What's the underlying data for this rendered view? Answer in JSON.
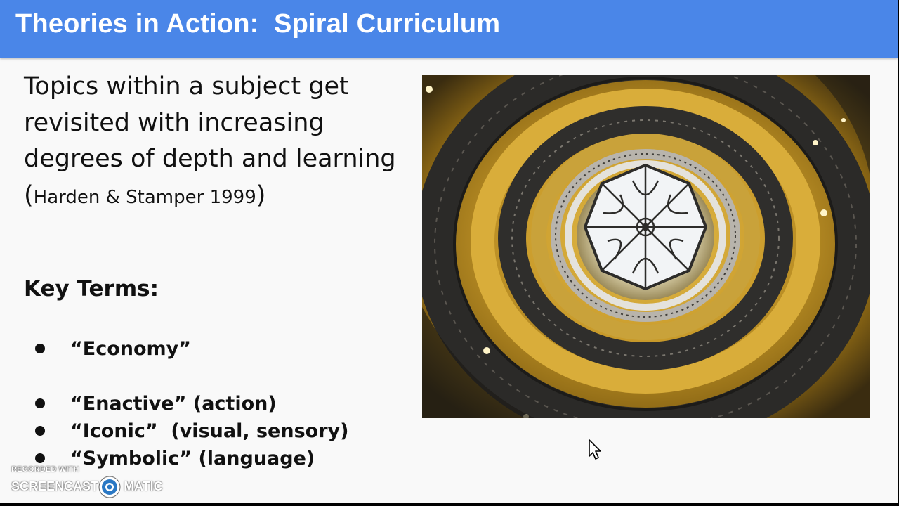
{
  "slide": {
    "title": "Theories in Action:  Spiral Curriculum",
    "body": {
      "main_text": "Topics within a subject get revisited with increasing degrees of depth and learning (",
      "citation": "Harden & Stamper 1999",
      "closing": ")"
    },
    "key_terms_heading": "Key Terms:",
    "key_terms": [
      "“Economy”",
      "“Enactive” (action)",
      "“Iconic”  (visual, sensory)",
      "“Symbolic” (language)"
    ],
    "image": {
      "subject": "spiral staircase viewed from below with octagonal skylight",
      "colors": {
        "gold": "#c89a2a",
        "dark": "#2b2a28",
        "skylight": "#f2f4f6"
      }
    }
  },
  "watermark": {
    "recorded_with": "RECORDED WITH",
    "brand_left": "SCREENCAST",
    "brand_right": "MATIC"
  },
  "theme": {
    "title_bar": "#4a86e8",
    "background": "#f9f9f9",
    "text": "#111111"
  }
}
